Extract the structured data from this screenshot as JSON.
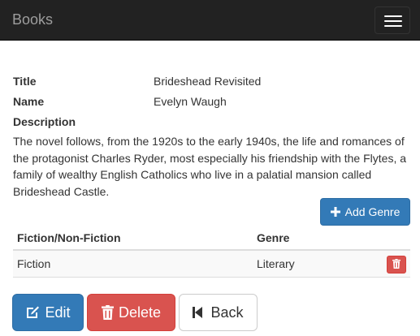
{
  "navbar": {
    "brand": "Books",
    "toggle_icon": "hamburger-icon"
  },
  "details": {
    "title_label": "Title",
    "title_value": "Brideshead Revisited",
    "name_label": "Name",
    "name_value": "Evelyn Waugh",
    "description_label": "Description",
    "description_value": "The novel follows, from the 1920s to the early 1940s, the life and romances of the protagonist Charles Ryder, most especially his friendship with the Flytes, a family of wealthy English Catholics who live in a palatial mansion called Brideshead Castle."
  },
  "genres": {
    "add_label": "Add Genre",
    "add_icon": "plus-icon",
    "columns": [
      "Fiction/Non-Fiction",
      "Genre"
    ],
    "rows": [
      {
        "type": "Fiction",
        "genre": "Literary",
        "delete_icon": "trash-icon"
      }
    ]
  },
  "actions": {
    "edit_label": "Edit",
    "edit_icon": "edit-icon",
    "delete_label": "Delete",
    "delete_icon": "trash-icon",
    "back_label": "Back",
    "back_icon": "step-backward-icon"
  },
  "colors": {
    "navbar": "#222222",
    "primary": "#337ab7",
    "danger": "#d9534f",
    "default": "#ffffff",
    "text": "#333333"
  }
}
